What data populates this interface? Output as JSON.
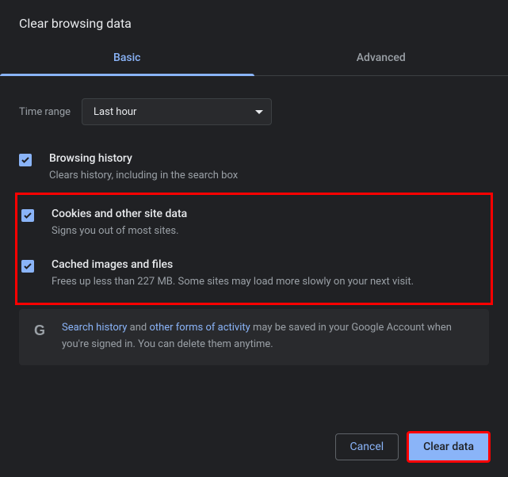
{
  "dialog": {
    "title": "Clear browsing data"
  },
  "tabs": {
    "basic": "Basic",
    "advanced": "Advanced"
  },
  "time": {
    "label": "Time range",
    "value": "Last hour"
  },
  "options": {
    "history": {
      "title": "Browsing history",
      "desc": "Clears history, including in the search box"
    },
    "cookies": {
      "title": "Cookies and other site data",
      "desc": "Signs you out of most sites."
    },
    "cache": {
      "title": "Cached images and files",
      "desc": "Frees up less than 227 MB. Some sites may load more slowly on your next visit."
    }
  },
  "info": {
    "prefix_link": "Search history",
    "mid": " and ",
    "mid_link": "other forms of activity",
    "suffix": " may be saved in your Google Account when you're signed in. You can delete them anytime."
  },
  "footer": {
    "cancel": "Cancel",
    "clear": "Clear data"
  }
}
